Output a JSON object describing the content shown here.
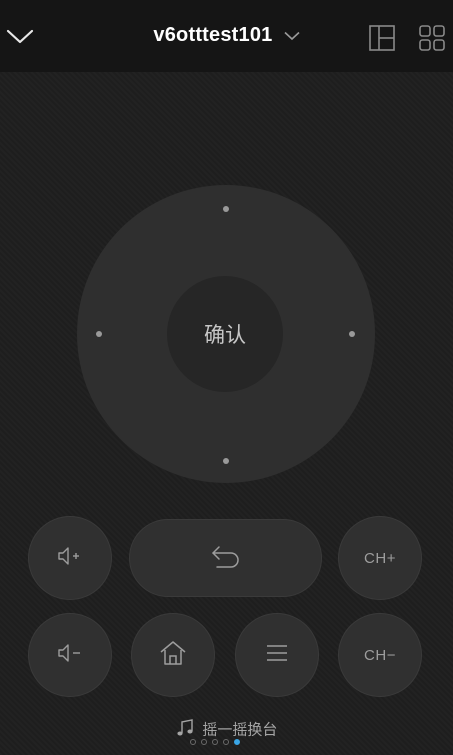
{
  "header": {
    "device_name": "v6otttest101",
    "icons": [
      "chevron-down-icon",
      "layout-icon",
      "grid-icon"
    ]
  },
  "dpad": {
    "ok_label": "确认"
  },
  "buttons": {
    "ch_up_label": "CH+",
    "ch_down_label": "CH−",
    "icons": [
      "volume-up-icon",
      "back-icon",
      "volume-down-icon",
      "home-icon",
      "menu-icon"
    ]
  },
  "footer": {
    "shake_label": "摇一摇换台",
    "pages": 5,
    "active_page": 5
  },
  "colors": {
    "background": "#1f1f1f",
    "topbar": "#151515",
    "dpad": "#2f2f2f",
    "button": "#303030",
    "active_dot": "#3aa6e6"
  }
}
